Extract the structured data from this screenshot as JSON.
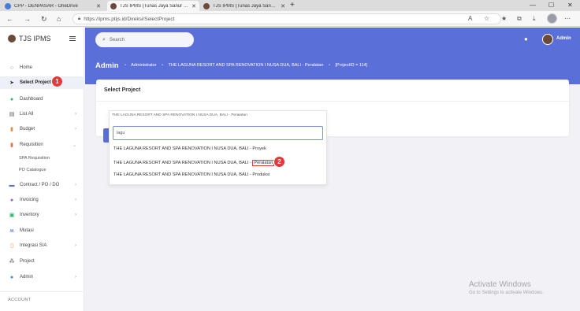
{
  "browser": {
    "tabs": [
      {
        "label": "CPP - DENPASAR - OneDrive",
        "active": false
      },
      {
        "label": "TJS IPMS (Tunas Jaya Sanur Interi...",
        "active": true
      },
      {
        "label": "TJS IPMS (Tunas Jaya Sanur Interi...",
        "active": false
      }
    ],
    "url": "https://ipms.ptijs.id/Direksi/SelectProject"
  },
  "app": {
    "name": "TJS IPMS",
    "search_placeholder": "Search",
    "user_name": "Admin"
  },
  "sidebar": {
    "items": [
      {
        "label": "Home",
        "icon": "home-icon"
      },
      {
        "label": "Select Project",
        "icon": "send-icon"
      },
      {
        "label": "Dashboard",
        "icon": "dashboard-icon"
      },
      {
        "label": "List All",
        "icon": "list-icon"
      },
      {
        "label": "Budget",
        "icon": "budget-icon"
      },
      {
        "label": "Requisition",
        "icon": "requisition-icon"
      },
      {
        "label": "Contract / PO / DO",
        "icon": "contract-icon"
      },
      {
        "label": "Invoicing",
        "icon": "invoice-icon"
      },
      {
        "label": "Inventory",
        "icon": "inventory-icon"
      },
      {
        "label": "Mutasi",
        "icon": "mutasi-icon"
      },
      {
        "label": "Integrasi SIA",
        "icon": "integration-icon"
      },
      {
        "label": "Project",
        "icon": "project-icon"
      },
      {
        "label": "Admin",
        "icon": "admin-icon"
      }
    ],
    "sub_items": [
      "SPA Requisition",
      "PO Catalogue"
    ],
    "account_label": "ACCOUNT"
  },
  "header": {
    "page_heading": "Admin",
    "breadcrumb": [
      "Administrator",
      "THE LAGUNA RESORT AND SPA RENOVATION I NUSA DUA, BALI - Peralatan",
      "[ProjectID = 114]"
    ]
  },
  "card": {
    "title": "Select Project"
  },
  "dropdown": {
    "selected": "THE LAGUNA RESORT AND SPA RENOVATION I NUSA DUA, BALI - Peralatan",
    "search_value": "lagu",
    "options": [
      {
        "prefix": "THE LAGUNA RESORT AND SPA RENOVATION I NUSA DUA, BALI - ",
        "suffix": "Proyek"
      },
      {
        "prefix": "THE LAGUNA RESORT AND SPA RENOVATION I NUSA DUA, BALI - ",
        "suffix": "Peralatan"
      },
      {
        "prefix": "THE LAGUNA RESORT AND SPA RENOVATION I NUSA DUA, BALI - ",
        "suffix": "Produksi"
      }
    ]
  },
  "markers": [
    "1",
    "2"
  ],
  "watermark": {
    "title": "Activate Windows",
    "subtitle": "Go to Settings to activate Windows."
  },
  "colors": {
    "accent": "#5a6fd8",
    "marker": "#e03b3b"
  }
}
